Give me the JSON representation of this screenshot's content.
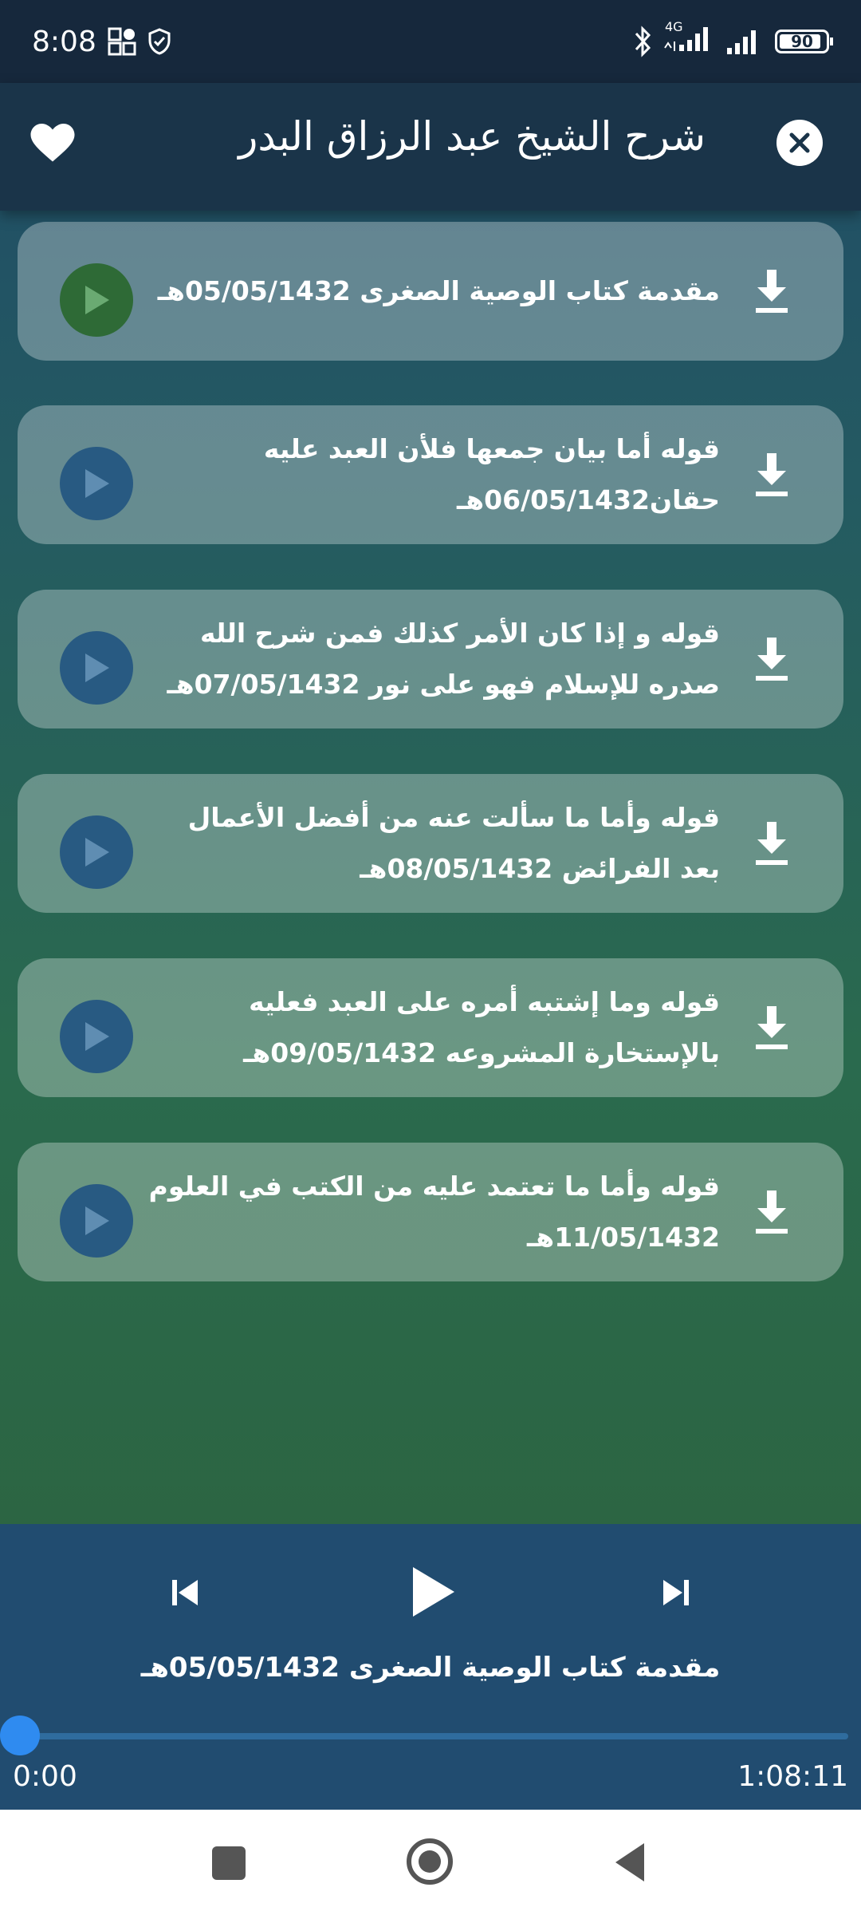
{
  "status_bar": {
    "time": "8:08",
    "network": "4G",
    "battery": "90"
  },
  "header": {
    "title": "شرح الشيخ عبد الرزاق البدر"
  },
  "lectures": [
    {
      "title": "مقدمة كتاب الوصية الصغرى 05/05/1432هـ",
      "active": true
    },
    {
      "title": "قوله أما بيان جمعها فلأن العبد عليه حقان06/05/1432هـ",
      "active": false
    },
    {
      "title": "قوله و إذا كان الأمر كذلك فمن شرح الله صدره للإسلام فهو على نور 07/05/1432هـ",
      "active": false
    },
    {
      "title": "قوله وأما ما سألت عنه من أفضل الأعمال بعد الفرائض 08/05/1432هـ",
      "active": false
    },
    {
      "title": "قوله وما إشتبه أمره على العبد فعليه بالإستخارة المشروعه 09/05/1432هـ",
      "active": false
    },
    {
      "title": "قوله وأما ما تعتمد عليه من الكتب في العلوم 11/05/1432هـ",
      "active": false
    }
  ],
  "player": {
    "track_title": "مقدمة كتاب الوصية الصغرى 05/05/1432هـ",
    "current_time": "0:00",
    "total_time": "1:08:11",
    "progress": 0
  },
  "colors": {
    "active_play": "#2e6a36",
    "play": "#285a82",
    "player_bg": "#214c70",
    "seek_thumb": "#2f8bf0"
  }
}
